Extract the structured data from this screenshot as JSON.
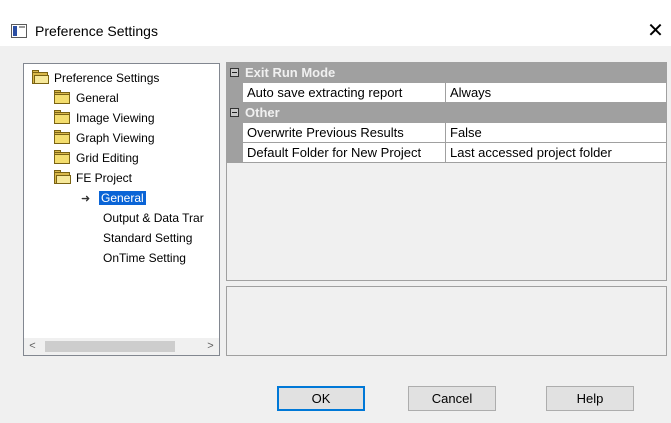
{
  "window": {
    "title": "Preference Settings",
    "close_glyph": "✕"
  },
  "tree": {
    "items": [
      {
        "label": "Preference Settings",
        "icon": "folder-open-icon"
      },
      {
        "label": "General",
        "icon": "folder-icon"
      },
      {
        "label": "Image Viewing",
        "icon": "folder-icon"
      },
      {
        "label": "Graph Viewing",
        "icon": "folder-icon"
      },
      {
        "label": "Grid Editing",
        "icon": "folder-icon"
      },
      {
        "label": "FE Project",
        "icon": "folder-open-icon"
      },
      {
        "label": "General",
        "icon": "arrow-right-icon",
        "selected": true
      },
      {
        "label": "Output & Data Trar"
      },
      {
        "label": "Standard Setting"
      },
      {
        "label": "OnTime Setting"
      }
    ],
    "scroll_left_glyph": "<",
    "scroll_right_glyph": ">"
  },
  "property_grid": {
    "categories": [
      {
        "label": "Exit Run Mode",
        "properties": [
          {
            "name": "Auto save extracting report",
            "value": "Always"
          }
        ]
      },
      {
        "label": "Other",
        "properties": [
          {
            "name": "Overwrite Previous Results",
            "value": "False"
          },
          {
            "name": "Default Folder for New Project",
            "value": "Last accessed project folder"
          }
        ]
      }
    ]
  },
  "buttons": {
    "ok": "OK",
    "cancel": "Cancel",
    "help": "Help"
  },
  "colors": {
    "selection": "#0a64d6",
    "category_bar": "#a0a0a0",
    "dialog_bg": "#f0f0f0"
  }
}
